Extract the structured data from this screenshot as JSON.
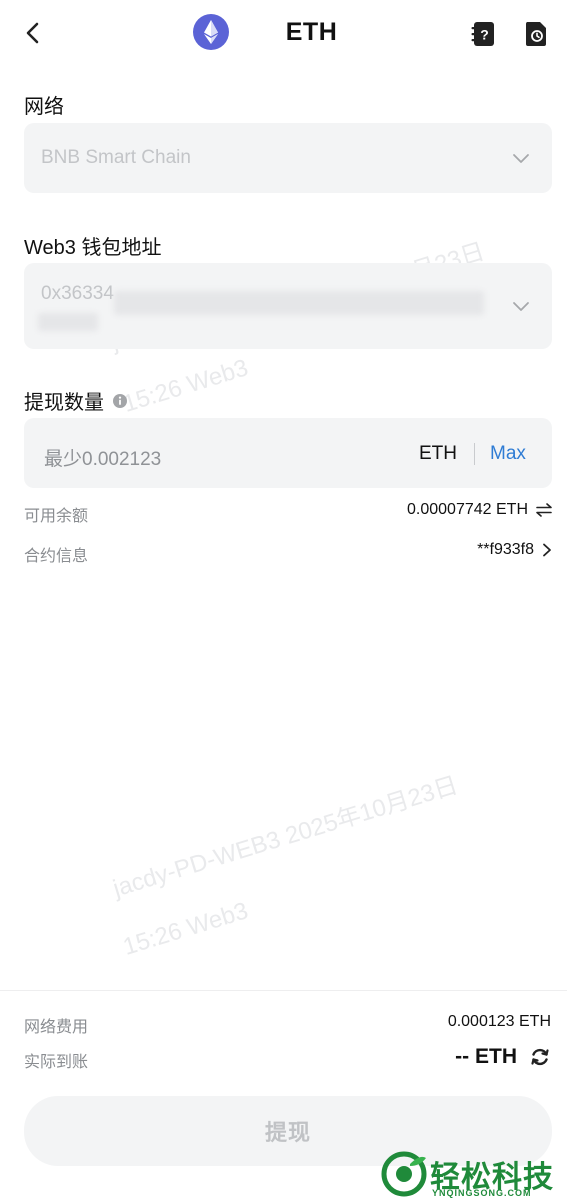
{
  "header": {
    "title": "ETH",
    "back_icon": "back-chevron-icon",
    "help_icon": "help-doc-icon",
    "history_icon": "history-doc-icon",
    "coin_color": "#5b63d6"
  },
  "network": {
    "label": "网络",
    "value": "BNB Smart Chain"
  },
  "address": {
    "label": "Web3 钱包地址",
    "value": "0x36334"
  },
  "amount": {
    "label": "提现数量",
    "placeholder": "最少0.002123",
    "unit": "ETH",
    "max_label": "Max"
  },
  "info": {
    "available_label": "可用余额",
    "available_value": "0.00007742 ETH",
    "contract_label": "合约信息",
    "contract_value": "**f933f8"
  },
  "watermarks": {
    "top_line1": "jacdy-PD-W",
    "top_line1_tail": "年10月23日",
    "top_line2": "15:26 Web3",
    "mid_line1": "jacdy-PD-WEB3 2025年10月23日",
    "mid_line2": "15:26 Web3"
  },
  "footer": {
    "fee_label": "网络费用",
    "fee_value": "0.000123 ETH",
    "receive_label": "实际到账",
    "receive_value": "-- ETH",
    "submit_label": "提现"
  },
  "brand": {
    "name": "轻松科技",
    "domain": "YNQINGSONG.COM",
    "color": "#1f8a3a"
  },
  "colors": {
    "accent": "#2f7cd4",
    "field_bg": "#f3f4f5"
  }
}
